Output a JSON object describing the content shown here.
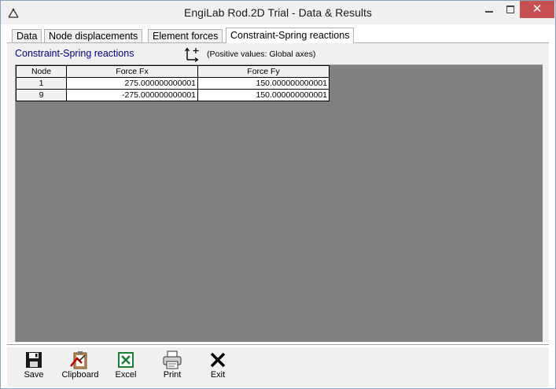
{
  "window": {
    "title": "EngiLab Rod.2D Trial - Data & Results",
    "close_glyph": "✕"
  },
  "tabs": [
    {
      "label": "Data",
      "active": false
    },
    {
      "label": "Node displacements",
      "active": false
    },
    {
      "label": "Element forces",
      "active": false
    },
    {
      "label": "Constraint-Spring reactions",
      "active": true
    }
  ],
  "panel": {
    "title": "Constraint-Spring reactions",
    "axes_note": "(Positive values: Global axes)"
  },
  "table": {
    "columns": [
      "Node",
      "Force Fx",
      "Force Fy"
    ],
    "rows": [
      [
        "1",
        "275.000000000001",
        "150.000000000001"
      ],
      [
        "9",
        "-275.000000000001",
        "150.000000000001"
      ]
    ]
  },
  "toolbar": {
    "save": "Save",
    "clipboard": "Clipboard",
    "excel": "Excel",
    "print": "Print",
    "exit": "Exit"
  },
  "icons": {
    "app": "rod-structure-icon",
    "axes": "global-axes-icon",
    "save": "floppy-disk-icon",
    "clipboard": "clipboard-icon",
    "excel": "excel-icon",
    "print": "printer-icon",
    "exit": "x-mark-icon"
  },
  "colors": {
    "close_button": "#c75050",
    "panel_title": "#000080",
    "grid_background": "#808080",
    "excel_green": "#1e7e34"
  }
}
